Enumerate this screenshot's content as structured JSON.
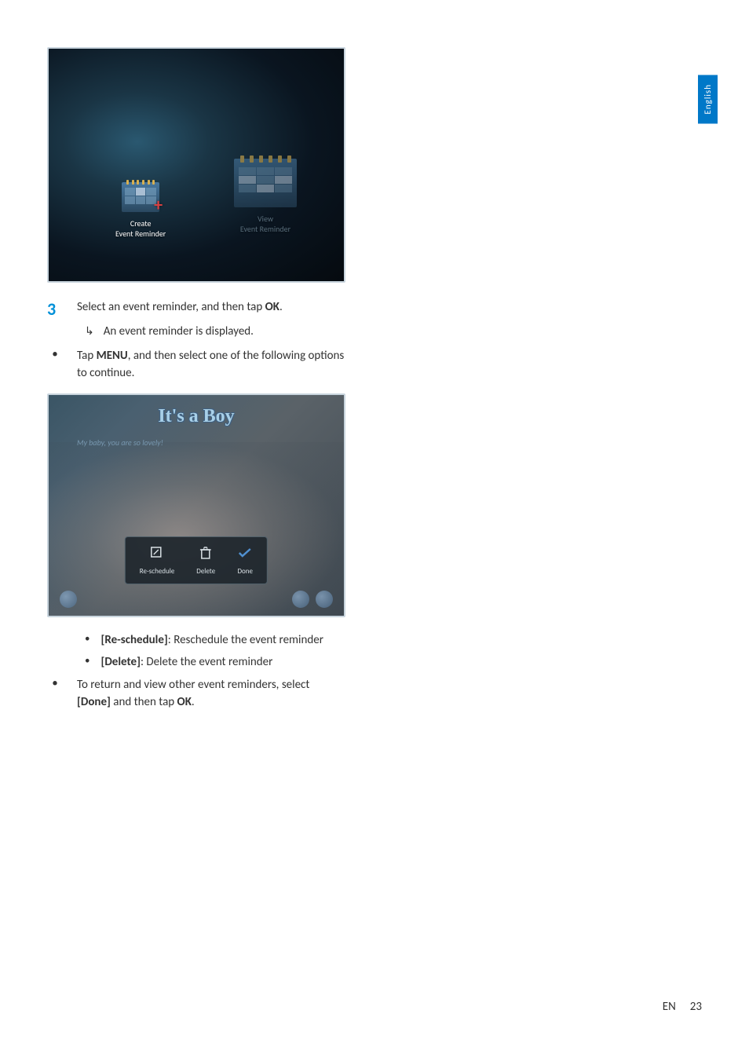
{
  "language_tab": "English",
  "screenshot1": {
    "create_label": "Create\nEvent Reminder",
    "view_label": "View\nEvent Reminder"
  },
  "step3": {
    "number": "3",
    "text_part1": "Select an event reminder, and then tap ",
    "ok": "OK",
    "text_part2": ".",
    "sub_text": "An event reminder is displayed."
  },
  "bullet1": {
    "text_part1": "Tap ",
    "menu": "MENU",
    "text_part2": ", and then select one of the following options to continue."
  },
  "screenshot2": {
    "title": "It's a Boy",
    "message": "My baby, you are so lovely!",
    "reschedule": "Re-schedule",
    "delete": "Delete",
    "done": "Done"
  },
  "options": {
    "reschedule_label": "[Re-schedule]",
    "reschedule_desc": ": Reschedule the event reminder",
    "delete_label": "[Delete]",
    "delete_desc": ": Delete the event reminder"
  },
  "bullet2": {
    "text_part1": "To return and view other event reminders, select ",
    "done": "[Done]",
    "text_part2": " and then tap ",
    "ok": "OK",
    "text_part3": "."
  },
  "footer": {
    "lang": "EN",
    "page": "23"
  }
}
